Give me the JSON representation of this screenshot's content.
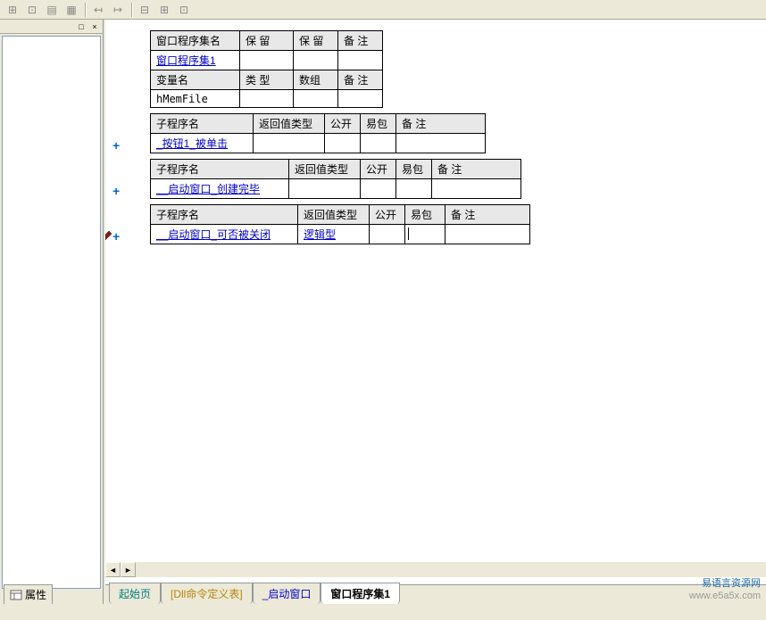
{
  "toolbar_icons": [
    "align-left",
    "align-center",
    "align-right",
    "align-justify",
    "indent-left",
    "indent-right",
    "sep",
    "width",
    "height",
    "zoom"
  ],
  "left_panel": {
    "close_icon": "×",
    "dock_icon": "□",
    "tab_label": "属性"
  },
  "tables": {
    "window_set": {
      "headers": [
        "窗口程序集名",
        "保 留",
        "保 留",
        "备 注"
      ],
      "row": [
        "窗口程序集1",
        "",
        "",
        ""
      ],
      "var_headers": [
        "变量名",
        "类 型",
        "数组",
        "备 注"
      ],
      "var_row": [
        "hMemFile",
        "",
        "",
        ""
      ]
    },
    "sub1": {
      "headers": [
        "子程序名",
        "返回值类型",
        "公开",
        "易包",
        "备 注"
      ],
      "row": [
        "_按钮1_被单击",
        "",
        "",
        "",
        ""
      ]
    },
    "sub2": {
      "headers": [
        "子程序名",
        "返回值类型",
        "公开",
        "易包",
        "备 注"
      ],
      "row": [
        "__启动窗口_创建完毕",
        "",
        "",
        "",
        ""
      ]
    },
    "sub3": {
      "headers": [
        "子程序名",
        "返回值类型",
        "公开",
        "易包",
        "备 注"
      ],
      "row": [
        "__启动窗口_可否被关闭",
        "逻辑型",
        "",
        "",
        ""
      ]
    }
  },
  "tabs": [
    {
      "label": "起始页",
      "cls": "teal"
    },
    {
      "label": "[Dll命令定义表]",
      "cls": "orange"
    },
    {
      "label": "_启动窗口",
      "cls": "blue"
    },
    {
      "label": "窗口程序集1",
      "cls": "active"
    }
  ],
  "watermark": {
    "line1": "易语言资源网",
    "line2": "www.e5a5x.com"
  },
  "plus_symbol": "+",
  "scroll_left": "◄",
  "scroll_right": "►"
}
